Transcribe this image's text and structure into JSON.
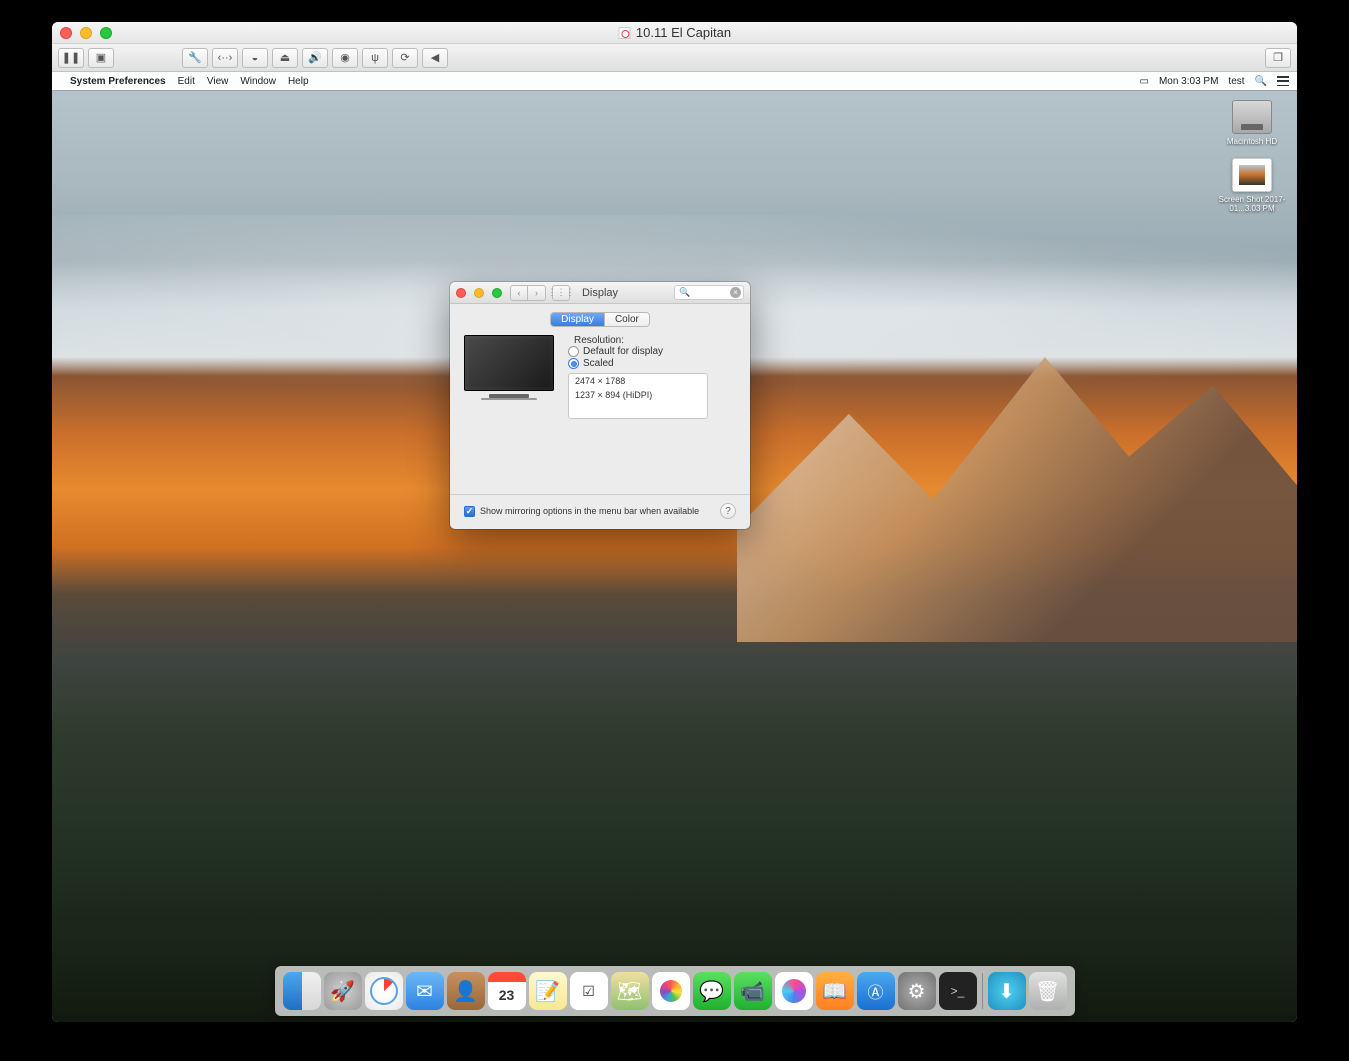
{
  "vm": {
    "title": "10.11 El Capitan",
    "toolbar_icons": {
      "pause": "pause-icon",
      "snapshot": "snapshot-icon",
      "wrench": "wrench-icon",
      "network": "network-icon",
      "disk": "disk-icon",
      "lock": "lock-icon",
      "sound": "sound-icon",
      "camera": "camera-icon",
      "usb": "usb-icon",
      "sync": "sync-icon",
      "back": "back-icon",
      "fullscreen": "fullscreen-icon"
    }
  },
  "menubar": {
    "app": "System Preferences",
    "items": [
      "Edit",
      "View",
      "Window",
      "Help"
    ],
    "clock": "Mon 3:03 PM",
    "user": "test"
  },
  "desktop_icons": {
    "hd": "Macintosh HD",
    "screenshot": "Screen Shot 2017-01...3.03 PM"
  },
  "prefs": {
    "title": "Display",
    "tabs": [
      "Display",
      "Color"
    ],
    "active_tab": 0,
    "resolution_label": "Resolution:",
    "radios": {
      "default": "Default for display",
      "scaled": "Scaled"
    },
    "selected_radio": "scaled",
    "resolutions": [
      "2474 × 1788",
      "1237 × 894 (HiDPI)"
    ],
    "mirror_checkbox": "Show mirroring options in the menu bar when available",
    "search_placeholder": ""
  },
  "dock": {
    "calendar_day": "23",
    "items": [
      {
        "name": "finder",
        "label": "Finder"
      },
      {
        "name": "launchpad",
        "label": "Launchpad"
      },
      {
        "name": "safari",
        "label": "Safari"
      },
      {
        "name": "mail",
        "label": "Mail"
      },
      {
        "name": "contacts",
        "label": "Contacts"
      },
      {
        "name": "calendar",
        "label": "Calendar"
      },
      {
        "name": "notes",
        "label": "Notes"
      },
      {
        "name": "reminders",
        "label": "Reminders"
      },
      {
        "name": "maps",
        "label": "Maps"
      },
      {
        "name": "photos",
        "label": "Photos"
      },
      {
        "name": "messages",
        "label": "Messages"
      },
      {
        "name": "facetime",
        "label": "FaceTime"
      },
      {
        "name": "itunes",
        "label": "iTunes"
      },
      {
        "name": "ibooks",
        "label": "iBooks"
      },
      {
        "name": "appstore",
        "label": "App Store"
      },
      {
        "name": "sysprefs",
        "label": "System Preferences"
      },
      {
        "name": "terminal",
        "label": "Terminal"
      }
    ]
  }
}
